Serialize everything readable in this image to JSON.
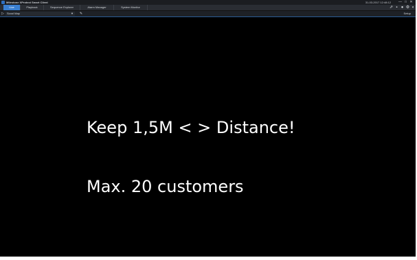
{
  "window": {
    "title": "Milestone XProtect Smart Client",
    "clock": "31-03-2017 12:48:12",
    "min_glyph": "—",
    "max_glyph": "□",
    "close_glyph": "✕"
  },
  "tabs": [
    {
      "label": "Live",
      "active": true
    },
    {
      "label": "Playback",
      "active": false
    },
    {
      "label": "Sequence Explorer",
      "active": false
    },
    {
      "label": "Alarm Manager",
      "active": false
    },
    {
      "label": "System Monitor",
      "active": false
    }
  ],
  "toolbar_icons": {
    "pin": "pin-icon",
    "camera": "camera-icon",
    "globe": "globe-icon",
    "gear": "gear-icon",
    "help": "help-icon"
  },
  "viewbar": {
    "view_name": "Scool Map",
    "setup_label": "Setup"
  },
  "video": {
    "line1": "Keep 1,5M < > Distance!",
    "line2": "Max. 20 customers"
  },
  "colors": {
    "accent": "#3a7fd0",
    "background": "#000000",
    "text": "#ffffff"
  }
}
